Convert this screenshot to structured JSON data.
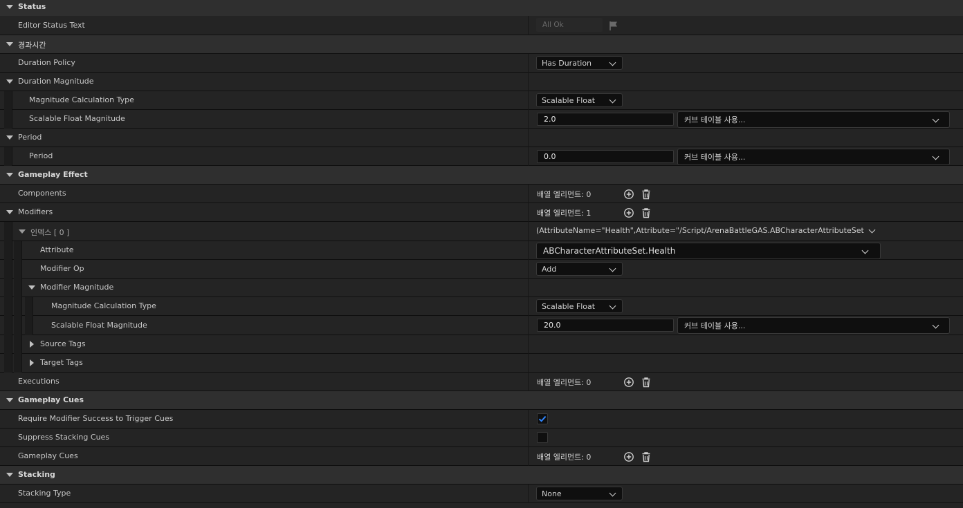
{
  "status": {
    "category": "Status",
    "editor_status_label": "Editor Status Text",
    "editor_status_value": "All Ok"
  },
  "duration": {
    "category": "경과시간",
    "policy_label": "Duration Policy",
    "policy_value": "Has Duration",
    "magnitude_label": "Duration Magnitude",
    "calc_type_label": "Magnitude Calculation Type",
    "calc_type_value": "Scalable Float",
    "scalable_label": "Scalable Float Magnitude",
    "scalable_value": "2.0",
    "curve_placeholder": "커브 테이블 사용..."
  },
  "period": {
    "category": "Period",
    "label": "Period",
    "value": "0.0",
    "curve_placeholder": "커브 테이블 사용..."
  },
  "gameplay_effect": {
    "category": "Gameplay Effect",
    "components_label": "Components",
    "components_value": "배열 엘리먼트: 0",
    "modifiers_label": "Modifiers",
    "modifiers_value": "배열 엘리먼트: 1",
    "index_label": "인덱스 [ 0 ]",
    "index_value": "(AttributeName=\"Health\",Attribute=\"/Script/ArenaBattleGAS.ABCharacterAttributeSet:Health\"",
    "attribute_label": "Attribute",
    "attribute_value": "ABCharacterAttributeSet.Health",
    "modifier_op_label": "Modifier Op",
    "modifier_op_value": "Add",
    "modifier_magnitude_label": "Modifier Magnitude",
    "mm_calc_type_label": "Magnitude Calculation Type",
    "mm_calc_type_value": "Scalable Float",
    "mm_scalable_label": "Scalable Float Magnitude",
    "mm_scalable_value": "20.0",
    "mm_curve_placeholder": "커브 테이블 사용...",
    "source_tags_label": "Source Tags",
    "target_tags_label": "Target Tags",
    "executions_label": "Executions",
    "executions_value": "배열 엘리먼트: 0"
  },
  "gameplay_cues": {
    "category": "Gameplay Cues",
    "require_label": "Require Modifier Success to Trigger Cues",
    "require_checked": true,
    "suppress_label": "Suppress Stacking Cues",
    "suppress_checked": false,
    "cues_label": "Gameplay Cues",
    "cues_value": "배열 엘리먼트: 0"
  },
  "stacking": {
    "category": "Stacking",
    "type_label": "Stacking Type",
    "type_value": "None"
  },
  "colors": {
    "accent": "#1f7cff",
    "background": "#1a1a1a",
    "category_row": "#2f2f2f",
    "property_row": "#242424"
  }
}
